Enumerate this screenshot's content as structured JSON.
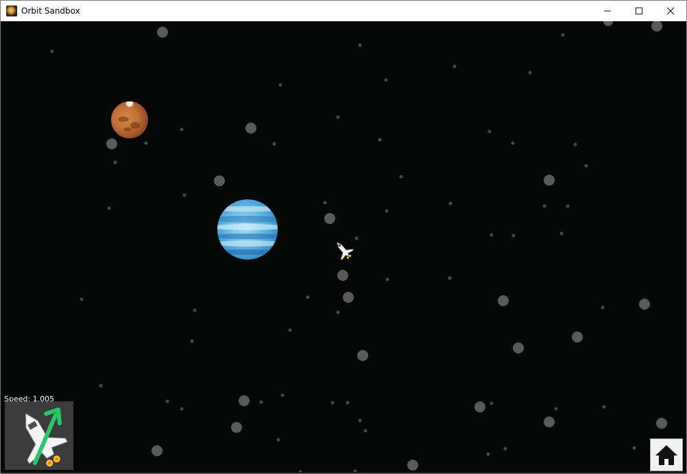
{
  "window": {
    "title": "Orbit Sandbox",
    "icons": {
      "app": "orbit-sandbox-app-icon",
      "minimize": "minimize-icon",
      "maximize": "maximize-icon",
      "close": "close-icon"
    }
  },
  "game": {
    "background_color": "#060707",
    "planets": [
      {
        "name": "mars",
        "colors": [
          "#d58a4b",
          "#8a4621"
        ]
      },
      {
        "name": "neptune",
        "colors": [
          "#6cc0e8",
          "#1c5e96"
        ]
      }
    ],
    "ship_icon": "space-shuttle-icon"
  },
  "hud": {
    "speed_label": "Speed: 1.005",
    "boost_icon": "shuttle-boost-icon",
    "boost_arrow_color": "#27c86a",
    "home_icon": "home-icon"
  }
}
